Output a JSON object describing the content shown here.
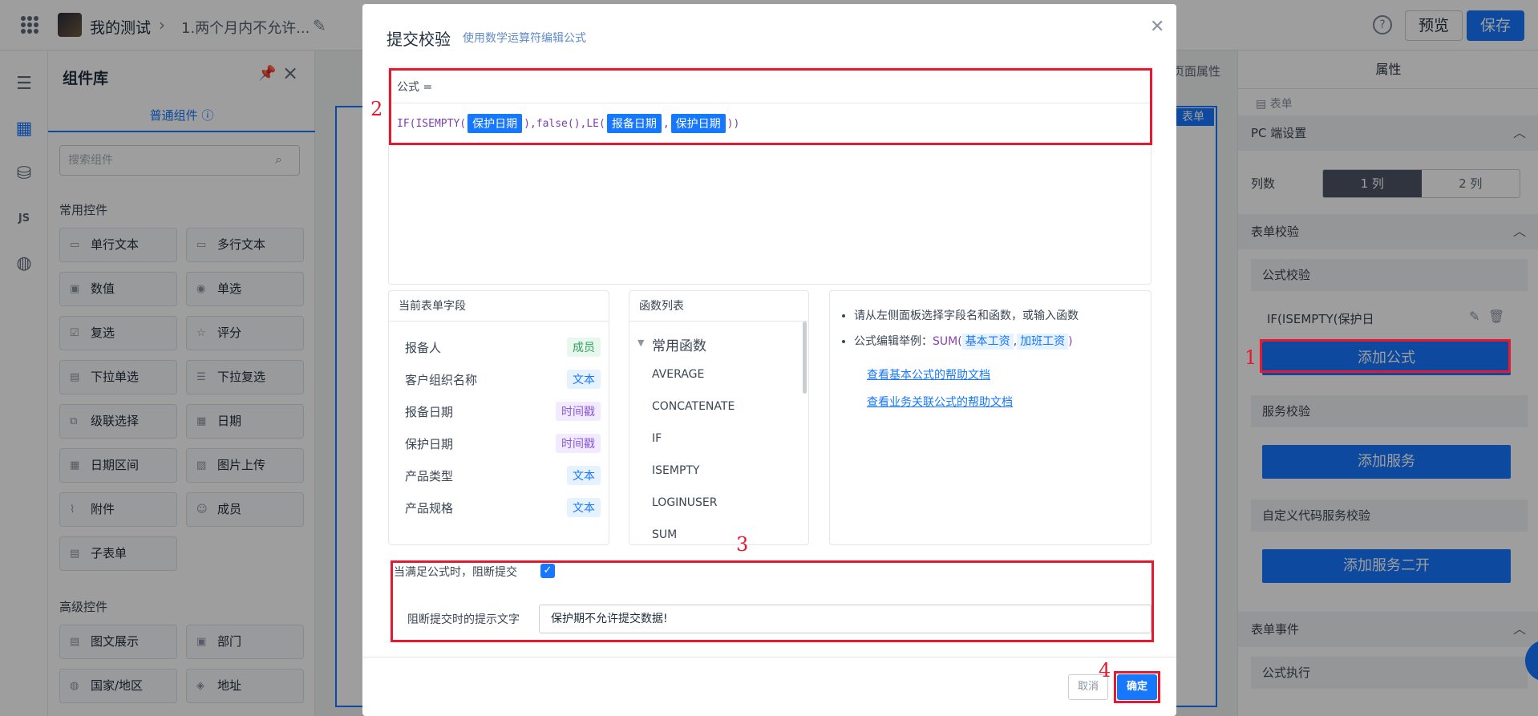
{
  "topbar": {
    "app_title": "我的测试",
    "page_name": "1.两个月内不允许...",
    "preview_label": "预览",
    "save_label": "保存"
  },
  "component_lib": {
    "title": "组件库",
    "tab": "普通组件",
    "search_placeholder": "搜索组件",
    "common_section": "常用控件",
    "common": [
      "单行文本",
      "多行文本",
      "数值",
      "单选",
      "复选",
      "评分",
      "下拉单选",
      "下拉复选",
      "级联选择",
      "日期",
      "日期区间",
      "图片上传",
      "附件",
      "成员",
      "子表单"
    ],
    "advanced_section": "高级控件",
    "advanced": [
      "图文展示",
      "部门",
      "国家/地区",
      "地址"
    ]
  },
  "canvas": {
    "page_attr": "页面属性",
    "form_tag": "表单"
  },
  "properties": {
    "tab": "属性",
    "form_crumb": "表单",
    "pc_settings": "PC 端设置",
    "columns_label": "列数",
    "col1": "1 列",
    "col2": "2 列",
    "form_validation": "表单校验",
    "formula_validation": "公式校验",
    "existing_formula": "IF(ISEMPTY(保护日",
    "add_formula": "添加公式",
    "service_validation": "服务校验",
    "add_service": "添加服务",
    "custom_code_validation": "自定义代码服务校验",
    "add_service_2": "添加服务二开",
    "form_events": "表单事件",
    "formula_exec": "公式执行"
  },
  "modal": {
    "title": "提交校验",
    "subtitle": "使用数学运算符编辑公式",
    "formula_label": "公式 =",
    "formula": {
      "p1": "IF(ISEMPTY(",
      "f1": "保护日期",
      "p2": "),false(),LE(",
      "f2": "报备日期",
      "p3": ",",
      "f3": "保护日期",
      "p4": "))"
    },
    "fields_header": "当前表单字段",
    "fields": [
      {
        "name": "报备人",
        "type": "成员"
      },
      {
        "name": "客户组织名称",
        "type": "文本"
      },
      {
        "name": "报备日期",
        "type": "时间戳"
      },
      {
        "name": "保护日期",
        "type": "时间戳"
      },
      {
        "name": "产品类型",
        "type": "文本"
      },
      {
        "name": "产品规格",
        "type": "文本"
      }
    ],
    "functions_header": "函数列表",
    "functions_group": "常用函数",
    "functions": [
      "AVERAGE",
      "CONCATENATE",
      "IF",
      "ISEMPTY",
      "LOGINUSER",
      "SUM"
    ],
    "help": {
      "tip1": "请从左侧面板选择字段名和函数，或输入函数",
      "tip2_prefix": "公式编辑举例：",
      "tip2_fn": "SUM(",
      "tip2_a": "基本工资",
      "tip2_sep": ",",
      "tip2_b": "加班工资",
      "tip2_end": ")",
      "link1": "查看基本公式的帮助文档",
      "link2": "查看业务关联公式的帮助文档"
    },
    "block_label": "当满足公式时，阻断提交",
    "tip_label": "阻断提交时的提示文字",
    "tip_value": "保护期不允许提交数据!",
    "cancel_label": "取消",
    "ok_label": "确定"
  },
  "annotations": [
    "1",
    "2",
    "3",
    "4"
  ],
  "colors": {
    "accent": "#1677ff",
    "annotation_red": "#e8182e"
  }
}
